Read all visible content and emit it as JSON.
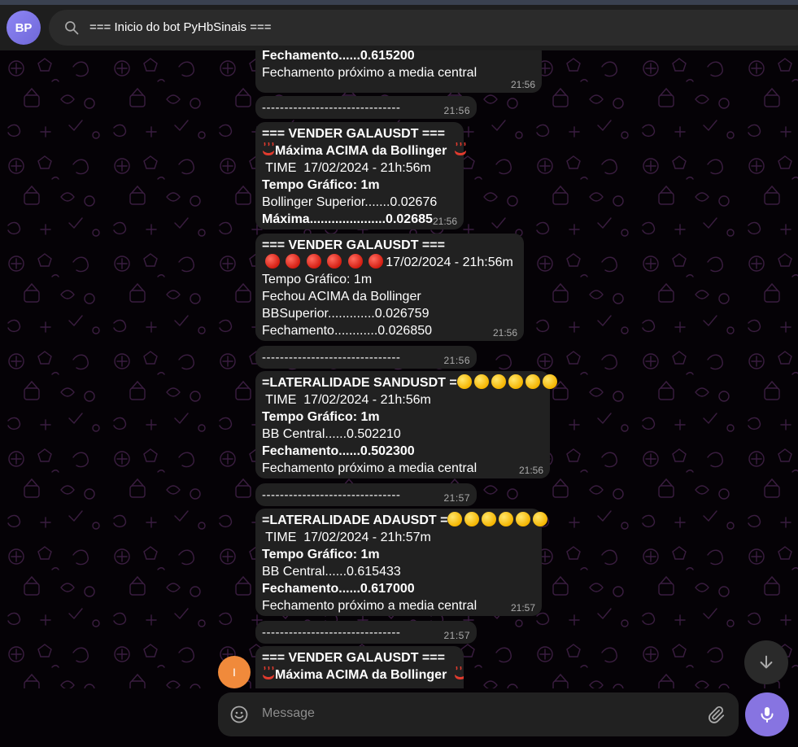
{
  "header": {
    "avatar_initials": "BP",
    "search_text": "=== Inicio do bot PyHbSinais ==="
  },
  "messages": {
    "m1": {
      "line1": "Fechamento......0.615200",
      "line2": "Fechamento próximo a media central",
      "time": "21:56"
    },
    "d1": {
      "text": "-------------------------------",
      "time": "21:56"
    },
    "m2": {
      "line1": "=== VENDER GALAUSDT ===",
      "line2": "Máxima ACIMA da Bollinger",
      "line3": " TIME  17/02/2024 - 21h:56m",
      "line4": "Tempo Gráfico: 1m",
      "line5": "Bollinger Superior.......0.02676",
      "line6": "Máxima.....................0.02685",
      "time": "21:56"
    },
    "m3": {
      "line1": "=== VENDER GALAUSDT ===",
      "line2": "17/02/2024 - 21h:56m",
      "line3": "Tempo Gráfico: 1m",
      "line4": "Fechou ACIMA da Bollinger",
      "line5": "BBSuperior.............0.026759",
      "line6": "Fechamento............0.026850",
      "time": "21:56"
    },
    "d2": {
      "text": "-------------------------------",
      "time": "21:56"
    },
    "m4": {
      "line1": "=LATERALIDADE SANDUSDT =",
      "line2": " TIME  17/02/2024 - 21h:56m",
      "line3": "Tempo Gráfico: 1m",
      "line4": "BB Central......0.502210",
      "line5": "Fechamento......0.502300",
      "line6": "Fechamento próximo a media central",
      "time": "21:56"
    },
    "d3": {
      "text": "-------------------------------",
      "time": "21:57"
    },
    "m5": {
      "line1": "=LATERALIDADE ADAUSDT =",
      "line2": " TIME  17/02/2024 - 21h:57m",
      "line3": "Tempo Gráfico: 1m",
      "line4": "BB Central......0.615433",
      "line5": "Fechamento......0.617000",
      "line6": "Fechamento próximo a media central",
      "time": "21:57"
    },
    "d4": {
      "text": "-------------------------------",
      "time": "21:57"
    },
    "m6": {
      "line1": "=== VENDER GALAUSDT ===",
      "line2": "Máxima ACIMA da Bollinger"
    }
  },
  "user_avatar_initial": "I",
  "composer": {
    "placeholder": "Message"
  },
  "icons": {
    "search": "search-icon",
    "emoji": "smiley-icon",
    "attach": "paperclip-icon",
    "mic": "microphone-icon",
    "scroll": "arrow-down-icon"
  },
  "colors": {
    "accent": "#8774e1",
    "bubble": "#212121",
    "header": "#1e1e1e"
  }
}
